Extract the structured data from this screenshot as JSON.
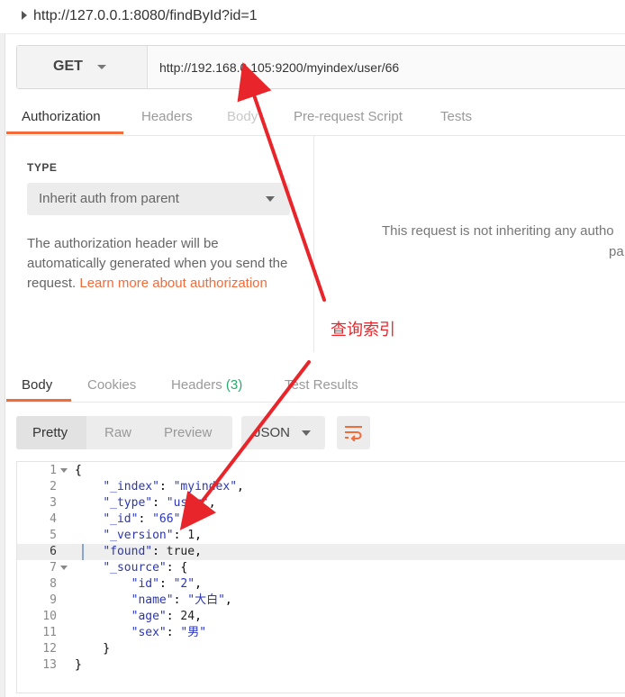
{
  "request": {
    "title": "http://127.0.0.1:8080/findById?id=1",
    "method": "GET",
    "url": "http://192.168.0.105:9200/myindex/user/66"
  },
  "request_tabs": [
    "Authorization",
    "Headers",
    "Body",
    "Pre-request Script",
    "Tests"
  ],
  "auth": {
    "type_label": "TYPE",
    "selected": "Inherit auth from parent",
    "description": "The authorization header will be automatically generated when you send the request. ",
    "link": "Learn more about authorization",
    "inherit_message_1": "This request is not inheriting any autho",
    "inherit_message_2": "pa"
  },
  "annotation": {
    "text": "查询索引",
    "color": "#e8252a"
  },
  "response_tabs": {
    "body": "Body",
    "cookies": "Cookies",
    "headers": "Headers",
    "headers_count": "(3)",
    "test_results": "Test Results"
  },
  "format": {
    "pretty": "Pretty",
    "raw": "Raw",
    "preview": "Preview",
    "language": "JSON",
    "wrap_icon": "wrap-lines-icon"
  },
  "response_body": {
    "lines": [
      "1",
      "2",
      "3",
      "4",
      "5",
      "6",
      "7",
      "8",
      "9",
      "10",
      "11",
      "12",
      "13"
    ],
    "highlighted_line": 6,
    "index_key": "\"_index\"",
    "index_val": "\"myindex\"",
    "type_key": "\"_type\"",
    "type_val": "\"user\"",
    "id_key": "\"_id\"",
    "id_val": "\"66\"",
    "version_key": "\"_version\"",
    "version_val": "1",
    "found_key": "\"found\"",
    "found_val": "true",
    "source_key": "\"_source\"",
    "s_id_key": "\"id\"",
    "s_id_val": "\"2\"",
    "s_name_key": "\"name\"",
    "s_name_val": "\"大白\"",
    "s_age_key": "\"age\"",
    "s_age_val": "24",
    "s_sex_key": "\"sex\"",
    "s_sex_val": "\"男\""
  },
  "colors": {
    "accent": "#f26b3a",
    "badge": "#26a96c"
  }
}
